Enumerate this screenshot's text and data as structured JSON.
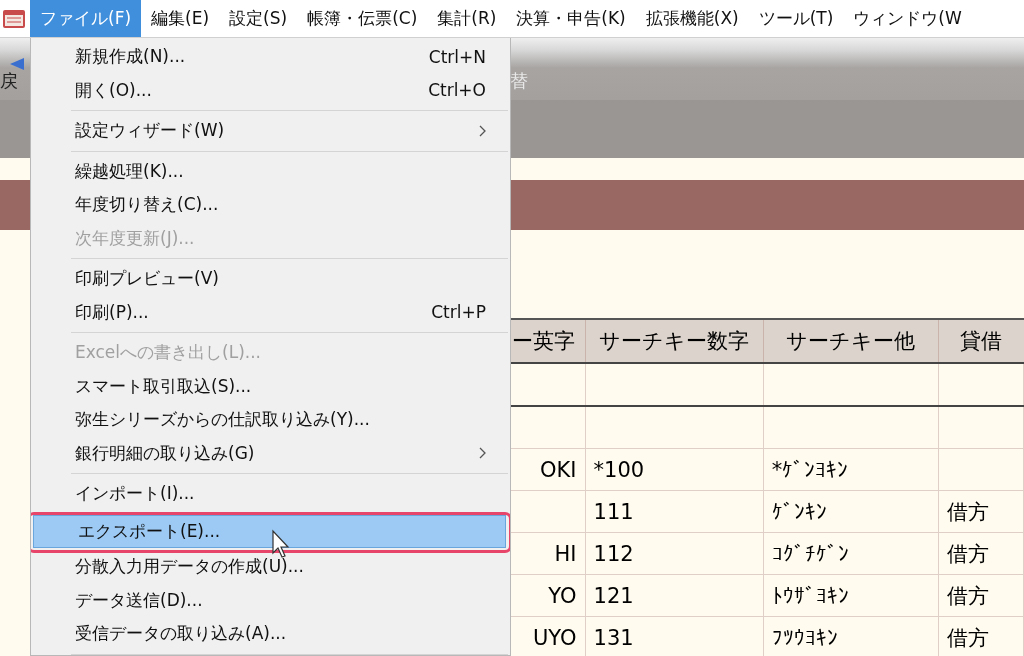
{
  "menubar": {
    "items": [
      {
        "label": "ファイル(F)",
        "selected": true
      },
      {
        "label": "編集(E)",
        "selected": false
      },
      {
        "label": "設定(S)",
        "selected": false
      },
      {
        "label": "帳簿・伝票(C)",
        "selected": false
      },
      {
        "label": "集計(R)",
        "selected": false
      },
      {
        "label": "決算・申告(K)",
        "selected": false
      },
      {
        "label": "拡張機能(X)",
        "selected": false
      },
      {
        "label": "ツール(T)",
        "selected": false
      },
      {
        "label": "ウィンドウ(W",
        "selected": false
      }
    ]
  },
  "toolbar": {
    "left_label": "戻",
    "right_label": "替"
  },
  "table": {
    "columns": [
      "ー英字",
      "サーチキー数字",
      "サーチキー他",
      "貸借"
    ],
    "rows": [
      {},
      {},
      {
        "column_1": "OKI",
        "column_2": "*100",
        "column_3": "*ｹﾞﾝﾖｷﾝ"
      },
      {
        "column_2": "111",
        "column_3": "ｹﾞﾝｷﾝ",
        "column_4": "借方"
      },
      {
        "column_1": "HI",
        "column_2": "112",
        "column_3": "ｺｸﾞﾁｹﾞﾝ",
        "column_4": "借方"
      },
      {
        "column_1": "YO",
        "column_2": "121",
        "column_3": "ﾄｳｻﾞﾖｷﾝ",
        "column_4": "借方"
      },
      {
        "column_1": "UYO",
        "column_2": "131",
        "column_3": "ﾌﾂｳﾖｷﾝ",
        "column_4": "借方"
      }
    ]
  },
  "file_menu": {
    "items": [
      {
        "kind": "item",
        "label": "新規作成(N)...",
        "shortcut": "Ctrl+N",
        "submenu": false,
        "disabled": false,
        "selected": false
      },
      {
        "kind": "item",
        "label": "開く(O)...",
        "shortcut": "Ctrl+O",
        "submenu": false,
        "disabled": false,
        "selected": false
      },
      {
        "kind": "separator"
      },
      {
        "kind": "item",
        "label": "設定ウィザード(W)",
        "submenu": true,
        "disabled": false,
        "selected": false
      },
      {
        "kind": "separator"
      },
      {
        "kind": "item",
        "label": "繰越処理(K)...",
        "submenu": false,
        "disabled": false,
        "selected": false
      },
      {
        "kind": "item",
        "label": "年度切り替え(C)...",
        "submenu": false,
        "disabled": false,
        "selected": false
      },
      {
        "kind": "item",
        "label": "次年度更新(J)...",
        "submenu": false,
        "disabled": true,
        "selected": false
      },
      {
        "kind": "separator"
      },
      {
        "kind": "item",
        "label": "印刷プレビュー(V)",
        "submenu": false,
        "disabled": false,
        "selected": false
      },
      {
        "kind": "item",
        "label": "印刷(P)...",
        "shortcut": "Ctrl+P",
        "submenu": false,
        "disabled": false,
        "selected": false
      },
      {
        "kind": "separator"
      },
      {
        "kind": "item",
        "label": "Excelへの書き出し(L)...",
        "submenu": false,
        "disabled": true,
        "selected": false
      },
      {
        "kind": "item",
        "label": "スマート取引取込(S)...",
        "submenu": false,
        "disabled": false,
        "selected": false
      },
      {
        "kind": "item",
        "label": "弥生シリーズからの仕訳取り込み(Y)...",
        "submenu": false,
        "disabled": false,
        "selected": false
      },
      {
        "kind": "item",
        "label": "銀行明細の取り込み(G)",
        "submenu": true,
        "disabled": false,
        "selected": false
      },
      {
        "kind": "separator"
      },
      {
        "kind": "item",
        "label": "インポート(I)...",
        "submenu": false,
        "disabled": false,
        "selected": false
      },
      {
        "kind": "item",
        "label": "エクスポート(E)...",
        "submenu": false,
        "disabled": false,
        "selected": true
      },
      {
        "kind": "item",
        "label": "分散入力用データの作成(U)...",
        "submenu": false,
        "disabled": false,
        "selected": false
      },
      {
        "kind": "item",
        "label": "データ送信(D)...",
        "submenu": false,
        "disabled": false,
        "selected": false
      },
      {
        "kind": "item",
        "label": "受信データの取り込み(A)...",
        "submenu": false,
        "disabled": false,
        "selected": false
      },
      {
        "kind": "separator"
      }
    ]
  }
}
